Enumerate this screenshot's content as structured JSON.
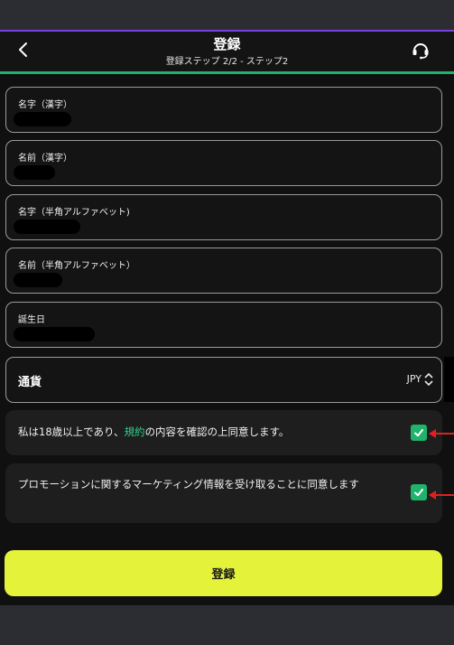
{
  "header": {
    "title": "登録",
    "subtitle": "登録ステップ 2/2 - ステップ2"
  },
  "fields": [
    {
      "label": "名字（漢字）"
    },
    {
      "label": "名前（漢字）"
    },
    {
      "label": "名字（半角アルファベット)"
    },
    {
      "label": "名前（半角アルファベット）"
    },
    {
      "label": "誕生日"
    }
  ],
  "currency": {
    "label": "通貨",
    "value": "JPY"
  },
  "consents": {
    "age": {
      "before": "私は18歳以上であり、",
      "link": "規約",
      "after": "の内容を確認の上同意します。",
      "checked": true
    },
    "marketing": {
      "text": "プロモーションに関するマーケティング情報を受け取ることに同意します",
      "checked": true
    }
  },
  "submit": {
    "label": "登録"
  },
  "colors": {
    "accent_green": "#1fb36b",
    "link_green": "#2fd08a",
    "button_yellow": "#e5f23a",
    "top_accent": "#7b3fe0",
    "annotation_arrow": "#e02020"
  },
  "icons": {
    "back": "chevron-left-icon",
    "support": "headset-icon",
    "currency_toggle": "up-down-chevron-icon",
    "checkbox": "checkmark-icon"
  }
}
